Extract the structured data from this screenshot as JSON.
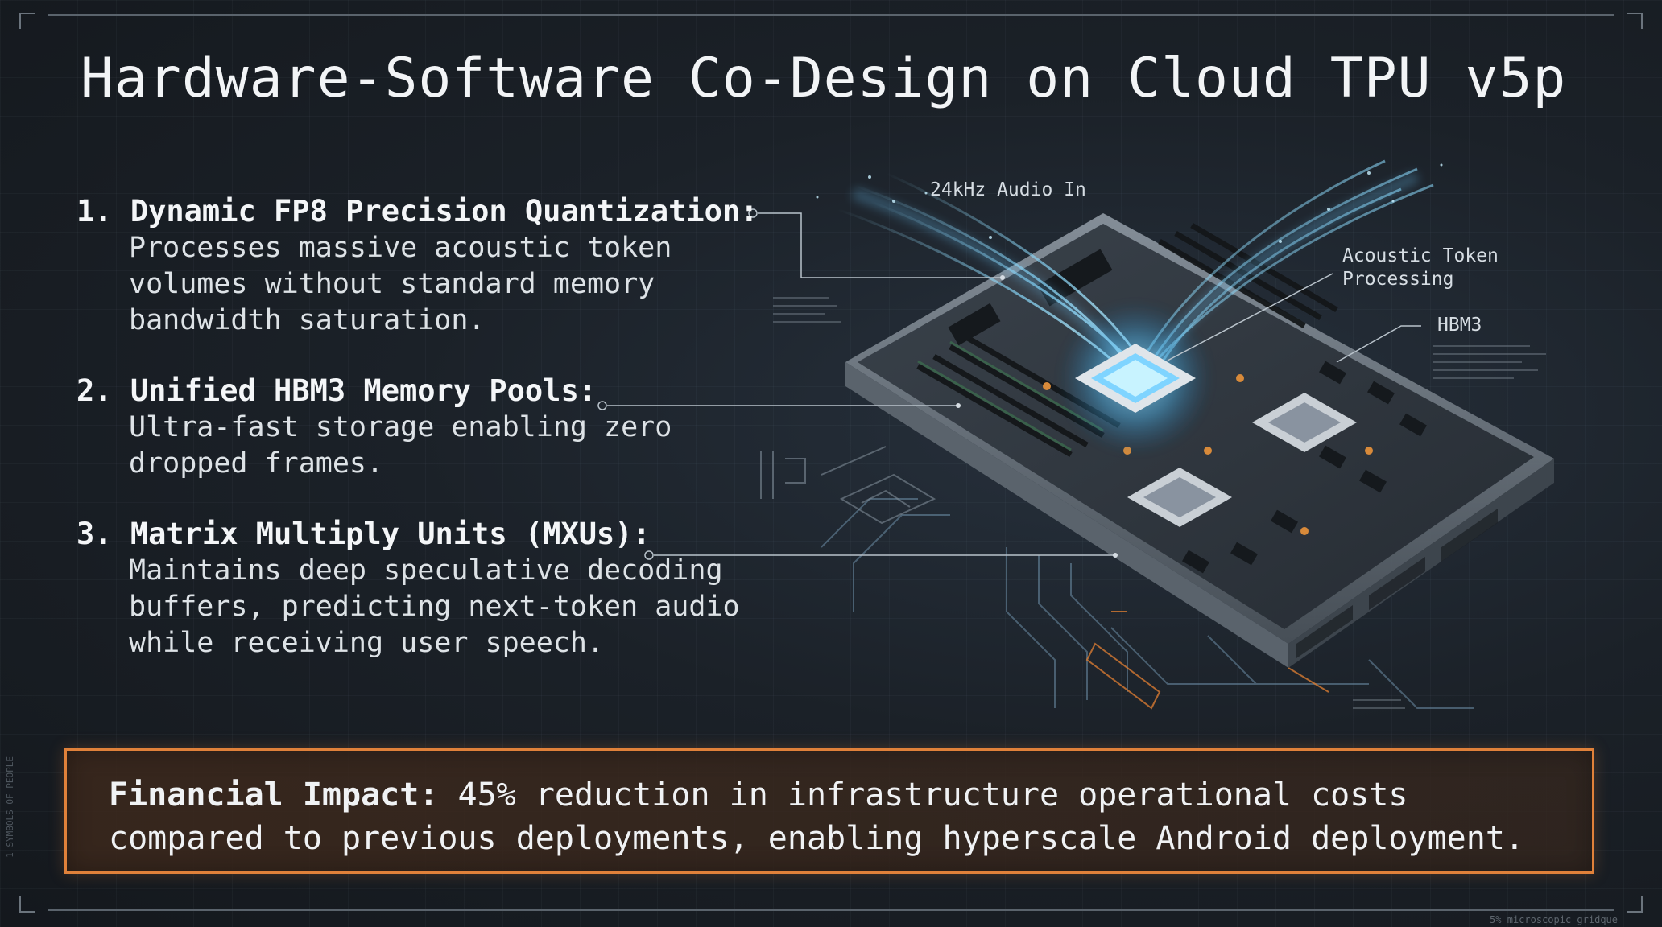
{
  "title": "Hardware-Software Co-Design on Cloud TPU v5p",
  "points": [
    {
      "heading": "1. Dynamic FP8 Precision Quantization:",
      "description": "Processes massive acoustic token volumes without standard memory bandwidth saturation."
    },
    {
      "heading": "2. Unified HBM3 Memory Pools:",
      "description": "Ultra-fast storage enabling zero dropped frames."
    },
    {
      "heading": "3. Matrix Multiply Units (MXUs):",
      "description": "Maintains deep speculative decoding buffers, predicting next-token audio while receiving user speech."
    }
  ],
  "diagram_labels": {
    "audio_in": "24kHz Audio In",
    "acoustic_line1": "Acoustic Token",
    "acoustic_line2": "Processing",
    "hbm3": "HBM3"
  },
  "impact": {
    "lead": "Financial Impact:",
    "text": " 45% reduction in infrastructure operational costs compared to previous deployments, enabling hyperscale Android deployment."
  },
  "footer_note": "5% microscopic gridque",
  "side_note": "1 SYMBOLS OF PEOPLE",
  "colors": {
    "accent_orange": "#e0813a",
    "glow_blue": "#7fd4ff",
    "background": "#1b2128"
  }
}
